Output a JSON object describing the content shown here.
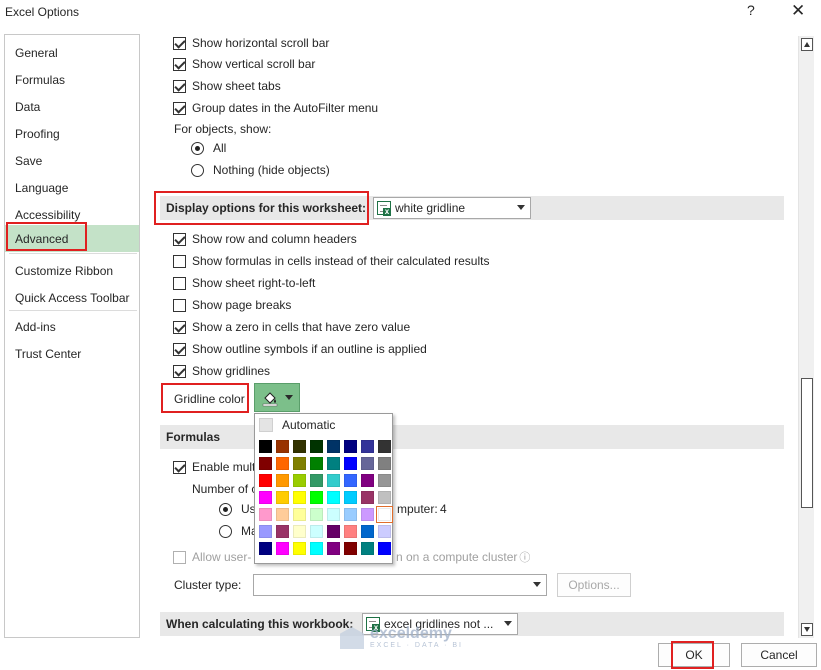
{
  "window": {
    "title": "Excel Options",
    "help_label": "?",
    "close_label": "✕"
  },
  "nav": {
    "items": [
      "General",
      "Formulas",
      "Data",
      "Proofing",
      "Save",
      "Language",
      "Accessibility",
      "Advanced",
      "Customize Ribbon",
      "Quick Access Toolbar",
      "Add-ins",
      "Trust Center"
    ],
    "active": "Advanced"
  },
  "options": {
    "horizontal_scroll": "Show horizontal scroll bar",
    "vertical_scroll": "Show vertical scroll bar",
    "sheet_tabs": "Show sheet tabs",
    "group_dates": "Group dates in the AutoFilter menu",
    "for_objects": "For objects, show:",
    "objects_all": "All",
    "objects_nothing": "Nothing (hide objects)"
  },
  "worksheet_section": {
    "title": "Display options for this worksheet:",
    "selected": "white gridline",
    "row_col_headers": "Show row and column headers",
    "formulas_in_cells": "Show formulas in cells instead of their calculated results",
    "right_to_left": "Show sheet right-to-left",
    "page_breaks": "Show page breaks",
    "zero_values": "Show a zero in cells that have zero value",
    "outline_symbols": "Show outline symbols if an outline is applied",
    "gridlines": "Show gridlines",
    "gridline_color_label": "Gridline color"
  },
  "formulas_section": {
    "title": "Formulas",
    "multithreaded": "Enable mult",
    "number_of": "Number of c",
    "use_all": "Use",
    "computer_suffix": "mputer:",
    "processor_count": "4",
    "manual": "Ma",
    "allow_udf_start": "Allow user-",
    "allow_udf_end": "n on a compute cluster",
    "cluster_type_label": "Cluster type:",
    "options_button": "Options..."
  },
  "calc_section": {
    "title": "When calculating this workbook:",
    "selected": "excel gridlines not ..."
  },
  "color_palette": {
    "automatic_label": "Automatic",
    "selected_color": "#ffffff",
    "colors": [
      "#000000",
      "#993300",
      "#333300",
      "#003300",
      "#003366",
      "#000080",
      "#333399",
      "#333333",
      "#800000",
      "#ff6600",
      "#808000",
      "#008000",
      "#008080",
      "#0000ff",
      "#666699",
      "#808080",
      "#ff0000",
      "#ff9900",
      "#99cc00",
      "#339966",
      "#33cccc",
      "#3366ff",
      "#800080",
      "#969696",
      "#ff00ff",
      "#ffcc00",
      "#ffff00",
      "#00ff00",
      "#00ffff",
      "#00ccff",
      "#993366",
      "#c0c0c0",
      "#ff99cc",
      "#ffcc99",
      "#ffff99",
      "#ccffcc",
      "#ccffff",
      "#99ccff",
      "#cc99ff",
      "#ffffff",
      "#9999ff",
      "#993366",
      "#ffffcc",
      "#ccffff",
      "#660066",
      "#ff8080",
      "#0066cc",
      "#ccccff",
      "#000080",
      "#ff00ff",
      "#ffff00",
      "#00ffff",
      "#800080",
      "#800000",
      "#008080",
      "#0000ff"
    ]
  },
  "footer": {
    "ok_label": "OK",
    "cancel_label": "Cancel"
  },
  "watermark": {
    "name": "exceldemy",
    "tagline": "EXCEL · DATA · BI"
  },
  "colors": {
    "accent_green": "#7cbf8a",
    "nav_active": "#c4e2c8",
    "highlight_red": "#e02020"
  }
}
